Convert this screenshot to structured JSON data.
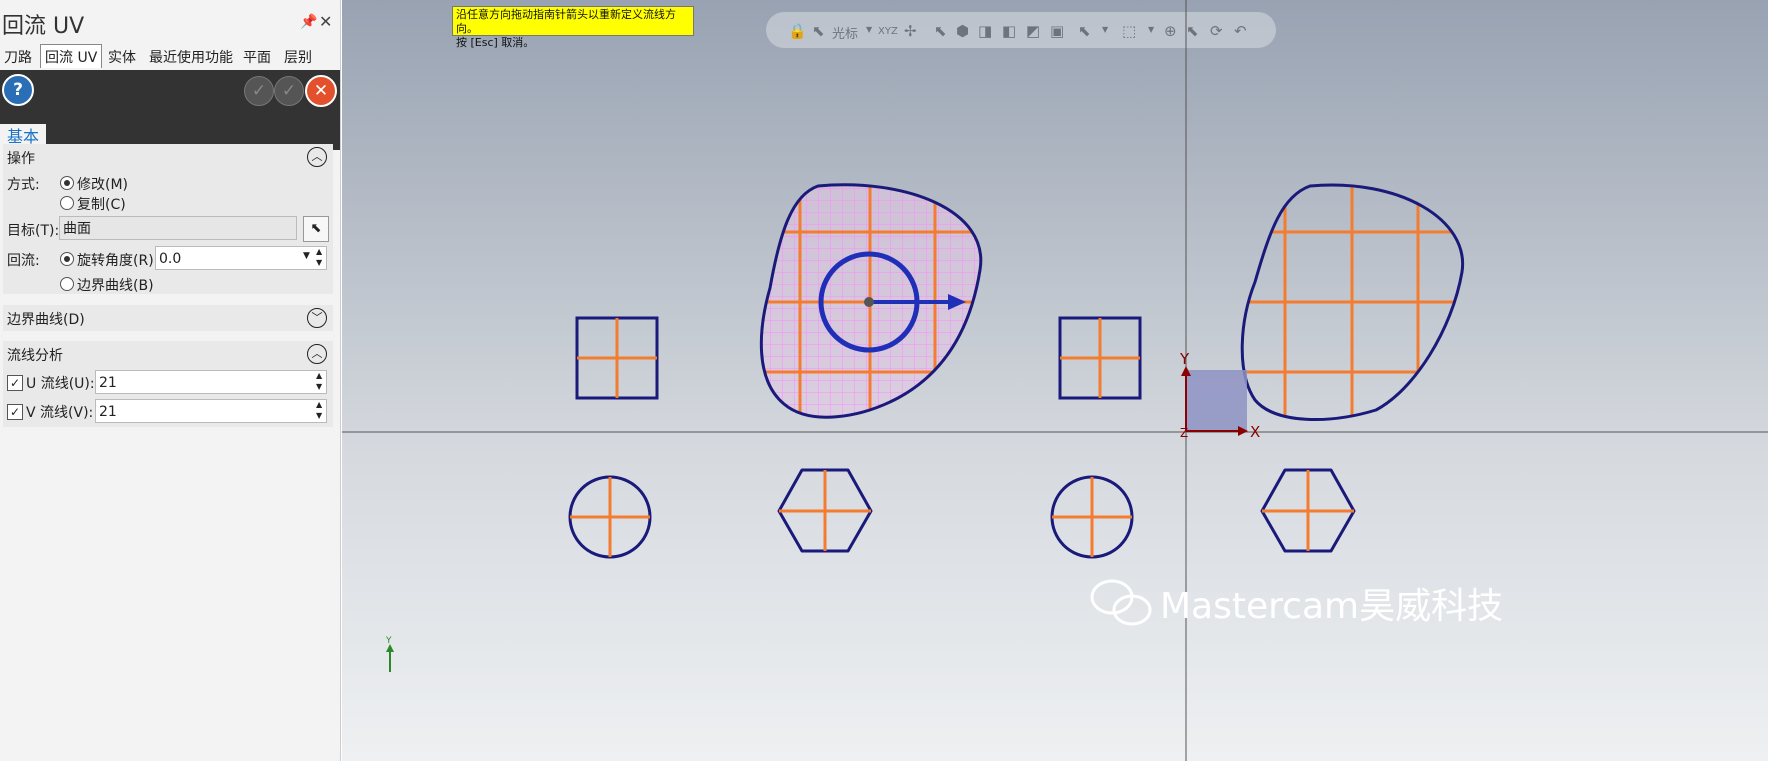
{
  "panel": {
    "title": "回流 UV",
    "pin_icon": "pin-icon",
    "close_icon": "close-icon",
    "tabs": [
      "刀路",
      "回流 UV",
      "实体",
      "最近使用功能",
      "平面",
      "层别"
    ],
    "active_tab": "回流 UV",
    "help_glyph": "?",
    "basic_tab": "基本",
    "operation": {
      "header": "操作",
      "method_label": "方式:",
      "modify": "修改(M)",
      "copy": "复制(C)",
      "target_label": "目标(T):",
      "target_value": "曲面",
      "flow_label": "回流:",
      "rotate_label": "旋转角度(R):",
      "rotate_value": "0.0",
      "boundary_label": "边界曲线(B)"
    },
    "boundary_group": {
      "header": "边界曲线(D)"
    },
    "analysis": {
      "header": "流线分析",
      "u_label": "U 流线(U):",
      "u_value": "21",
      "v_label": "V 流线(V):",
      "v_value": "21"
    },
    "colors": {
      "help": "#2a6fb6",
      "ok": "#4a4a4a",
      "cancel": "#e2502c",
      "tab_active_text": "#1a73c7"
    }
  },
  "viewport": {
    "tooltip_line1": "沿任意方向拖动指南针箭头以重新定义流线方向。",
    "tooltip_line2": "按 [Esc] 取消。",
    "toolbar_label": "光标",
    "toolbar_xyz": "XYZ",
    "axis_x": "X",
    "axis_y": "Y",
    "axis_z": "Z",
    "small_axis_y": "Y",
    "watermark": "Mastercam昊威科技",
    "colors": {
      "outline": "#1a1a7a",
      "flowline": "#f47c30",
      "uv_grid": "#ff88ff",
      "axis_x": "#8b0000",
      "axis_y": "#8b0000"
    }
  }
}
